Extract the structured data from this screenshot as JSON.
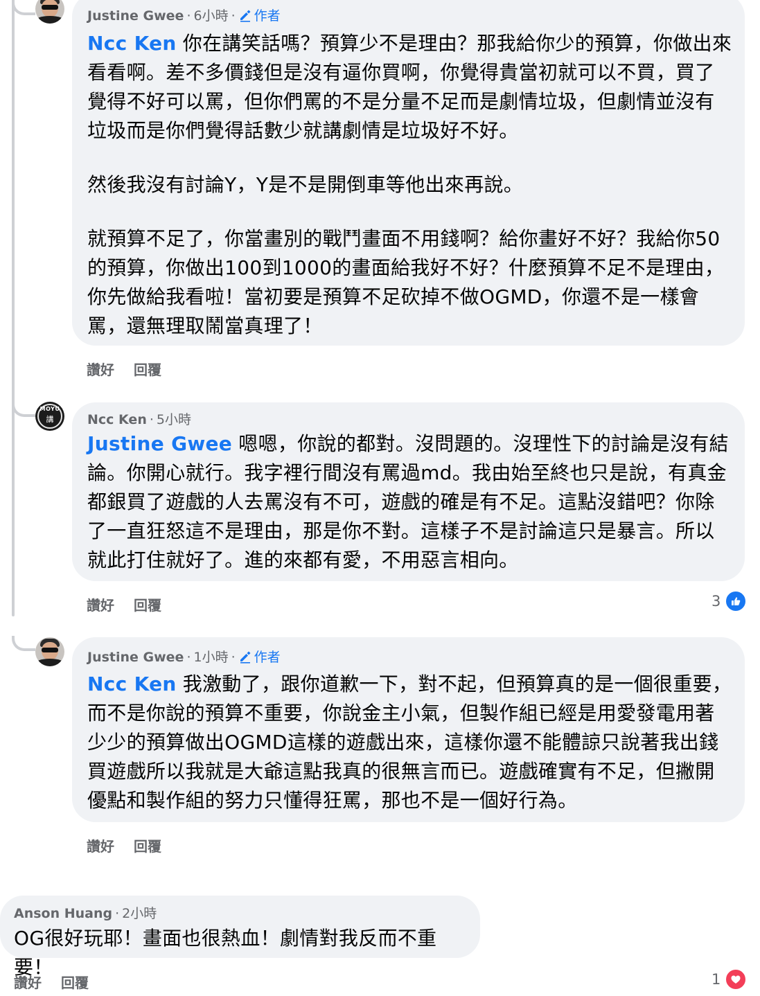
{
  "colors": {
    "mention": "#1877f2",
    "meta": "#65676b",
    "bubble": "#f0f2f5",
    "like": "#1877f2",
    "love": "#f33e58"
  },
  "comments": [
    {
      "author": "Justine Gwee",
      "time": "6小時",
      "badge": "作者",
      "mention": "Ncc Ken",
      "lead": " 你在講笑話嗎？預算少不是理由？那我給你少的預算，你做出來看看啊。差不多價錢但是沒有逼你買啊，你覺得貴當初就可以不買，買了覺得不好可以罵，但你們罵的不是分量不足而是劇情垃圾，但劇情並沒有垃圾而是你們覺得話數少就講劇情是垃圾好不好。",
      "p2": "然後我沒有討論Y，Y是不是開倒車等他出來再說。",
      "p3": "就預算不足了，你當畫別的戰鬥畫面不用錢啊？給你畫好不好？我給你50的預算，你做出100到1000的畫面給我好不好？什麼預算不足不是理由，你先做給我看啦！當初要是預算不足砍掉不做OGMD，你還不是一樣會罵，還無理取鬧當真理了！",
      "like": "讚好",
      "reply": "回覆"
    },
    {
      "author": "Ncc Ken",
      "time": "5小時",
      "mention": "Justine Gwee",
      "lead": " 嗯嗯，你說的都對。沒問題的。沒理性下的討論是沒有結論。你開心就行。我字裡行間沒有罵過md。我由始至終也只是說，有真金都銀買了遊戲的人去罵沒有不可，遊戲的確是有不足。這點沒錯吧？你除了一直狂怒這不是理由，那是你不對。這樣子不是討論這只是暴言。所以就此打住就好了。進的來都有愛，不用惡言相向。",
      "like": "讚好",
      "reply": "回覆",
      "reactions": "3",
      "avatar_text1": "MOYU",
      "avatar_text2": "講"
    },
    {
      "author": "Justine Gwee",
      "time": "1小時",
      "badge": "作者",
      "mention": "Ncc Ken",
      "lead": " 我激動了，跟你道歉一下，對不起，但預算真的是一個很重要，而不是你說的預算不重要，你說金主小氣，但製作組已經是用愛發電用著少少的預算做出OGMD這樣的遊戲出來，這樣你還不能體諒只說著我出錢買遊戲所以我就是大爺這點我真的很無言而已。遊戲確實有不足，但撇開優點和製作組的努力只懂得狂罵，那也不是一個好行為。",
      "like": "讚好",
      "reply": "回覆"
    },
    {
      "author": "Anson Huang",
      "time": "2小時",
      "text": "OG很好玩耶！畫面也很熱血！劇情對我反而不重要！",
      "like": "讚好",
      "reply": "回覆",
      "reactions": "1"
    }
  ]
}
